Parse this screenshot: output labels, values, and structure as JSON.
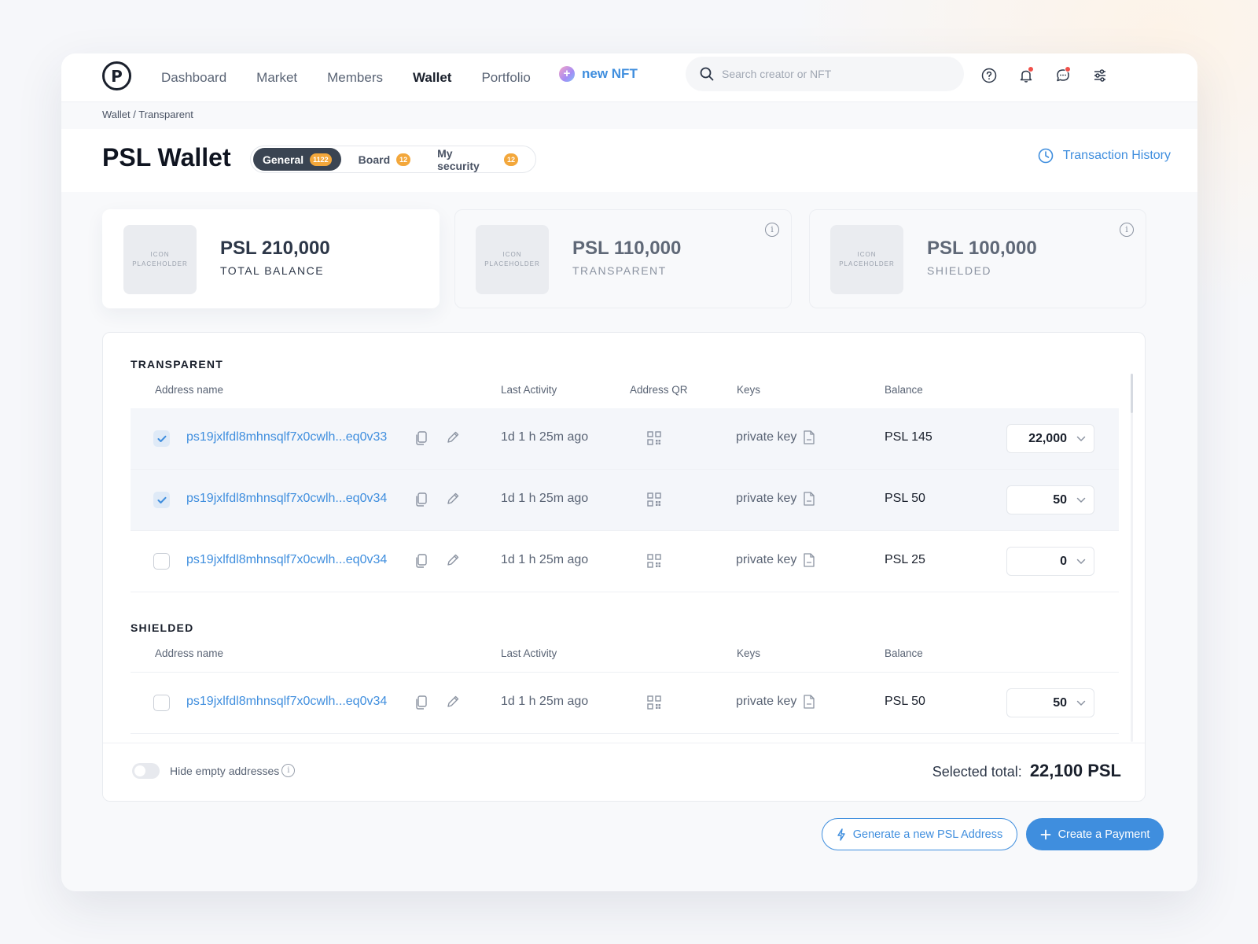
{
  "nav": {
    "items": [
      "Dashboard",
      "Market",
      "Members",
      "Wallet",
      "Portfolio"
    ],
    "new_nft": "new NFT",
    "new_nft_plus": "+"
  },
  "search": {
    "placeholder": "Search creator or NFT"
  },
  "breadcrumb": "Wallet / Transparent",
  "title": "PSL Wallet",
  "tabs": [
    {
      "label": "General",
      "badge": "1122"
    },
    {
      "label": "Board",
      "badge": "12"
    },
    {
      "label": "My security",
      "badge": "12"
    }
  ],
  "transaction_history": "Transaction History",
  "cards": [
    {
      "placeholder": "ICON PLACEHOLDER",
      "amount": "PSL 210,000",
      "label": "TOTAL BALANCE"
    },
    {
      "placeholder": "ICON PLACEHOLDER",
      "amount": "PSL 110,000",
      "label": "TRANSPARENT",
      "info": "i"
    },
    {
      "placeholder": "ICON PLACEHOLDER",
      "amount": "PSL 100,000",
      "label": "SHIELDED",
      "info": "i"
    }
  ],
  "transparent": {
    "title": "TRANSPARENT",
    "headers": {
      "address": "Address name",
      "activity": "Last Activity",
      "qr": "Address QR",
      "keys": "Keys",
      "balance": "Balance"
    },
    "rows": [
      {
        "address": "ps19jxlfdl8mhnsqlf7x0cwlh...eq0v33",
        "activity": "1d 1 h 25m ago",
        "keys": "private key",
        "balance": "PSL 145",
        "amount": "22,000",
        "checked": true
      },
      {
        "address": "ps19jxlfdl8mhnsqlf7x0cwlh...eq0v34",
        "activity": "1d 1 h 25m ago",
        "keys": "private key",
        "balance": "PSL 50",
        "amount": "50",
        "checked": true
      },
      {
        "address": "ps19jxlfdl8mhnsqlf7x0cwlh...eq0v34",
        "activity": "1d 1 h 25m ago",
        "keys": "private key",
        "balance": "PSL 25",
        "amount": "0",
        "checked": false
      }
    ]
  },
  "shielded": {
    "title": "SHIELDED",
    "headers": {
      "address": "Address name",
      "activity": "Last Activity",
      "keys": "Keys",
      "balance": "Balance"
    },
    "rows": [
      {
        "address": "ps19jxlfdl8mhnsqlf7x0cwlh...eq0v34",
        "activity": "1d 1 h 25m ago",
        "keys": "private key",
        "balance": "PSL 50",
        "amount": "50",
        "checked": false
      }
    ]
  },
  "footer": {
    "hide_empty": "Hide empty addresses",
    "info": "i",
    "selected_total_label": "Selected total:",
    "selected_total_value": "22,100 PSL"
  },
  "buttons": {
    "generate": "Generate a new PSL Address",
    "create_payment": "Create a Payment"
  },
  "colors": {
    "accent": "#3f8ede",
    "badge": "#f3a73b",
    "active_tab": "#3a4452"
  }
}
